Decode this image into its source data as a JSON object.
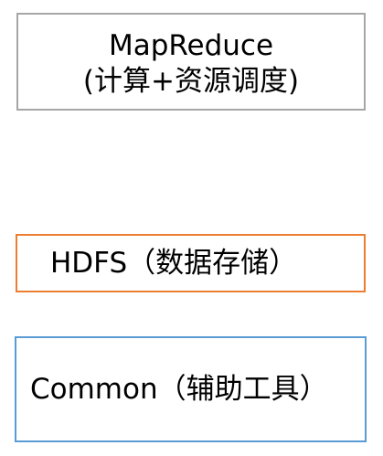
{
  "diagram": {
    "layers": [
      {
        "id": "mapreduce",
        "lines": [
          "MapReduce",
          "(计算+资源调度)"
        ],
        "border_color": "#a6a6a6"
      },
      {
        "id": "hdfs",
        "lines": [
          "HDFS（数据存储）"
        ],
        "border_color": "#ed7d31"
      },
      {
        "id": "common",
        "lines": [
          "Common（辅助工具）"
        ],
        "border_color": "#5b9bd5"
      }
    ]
  }
}
